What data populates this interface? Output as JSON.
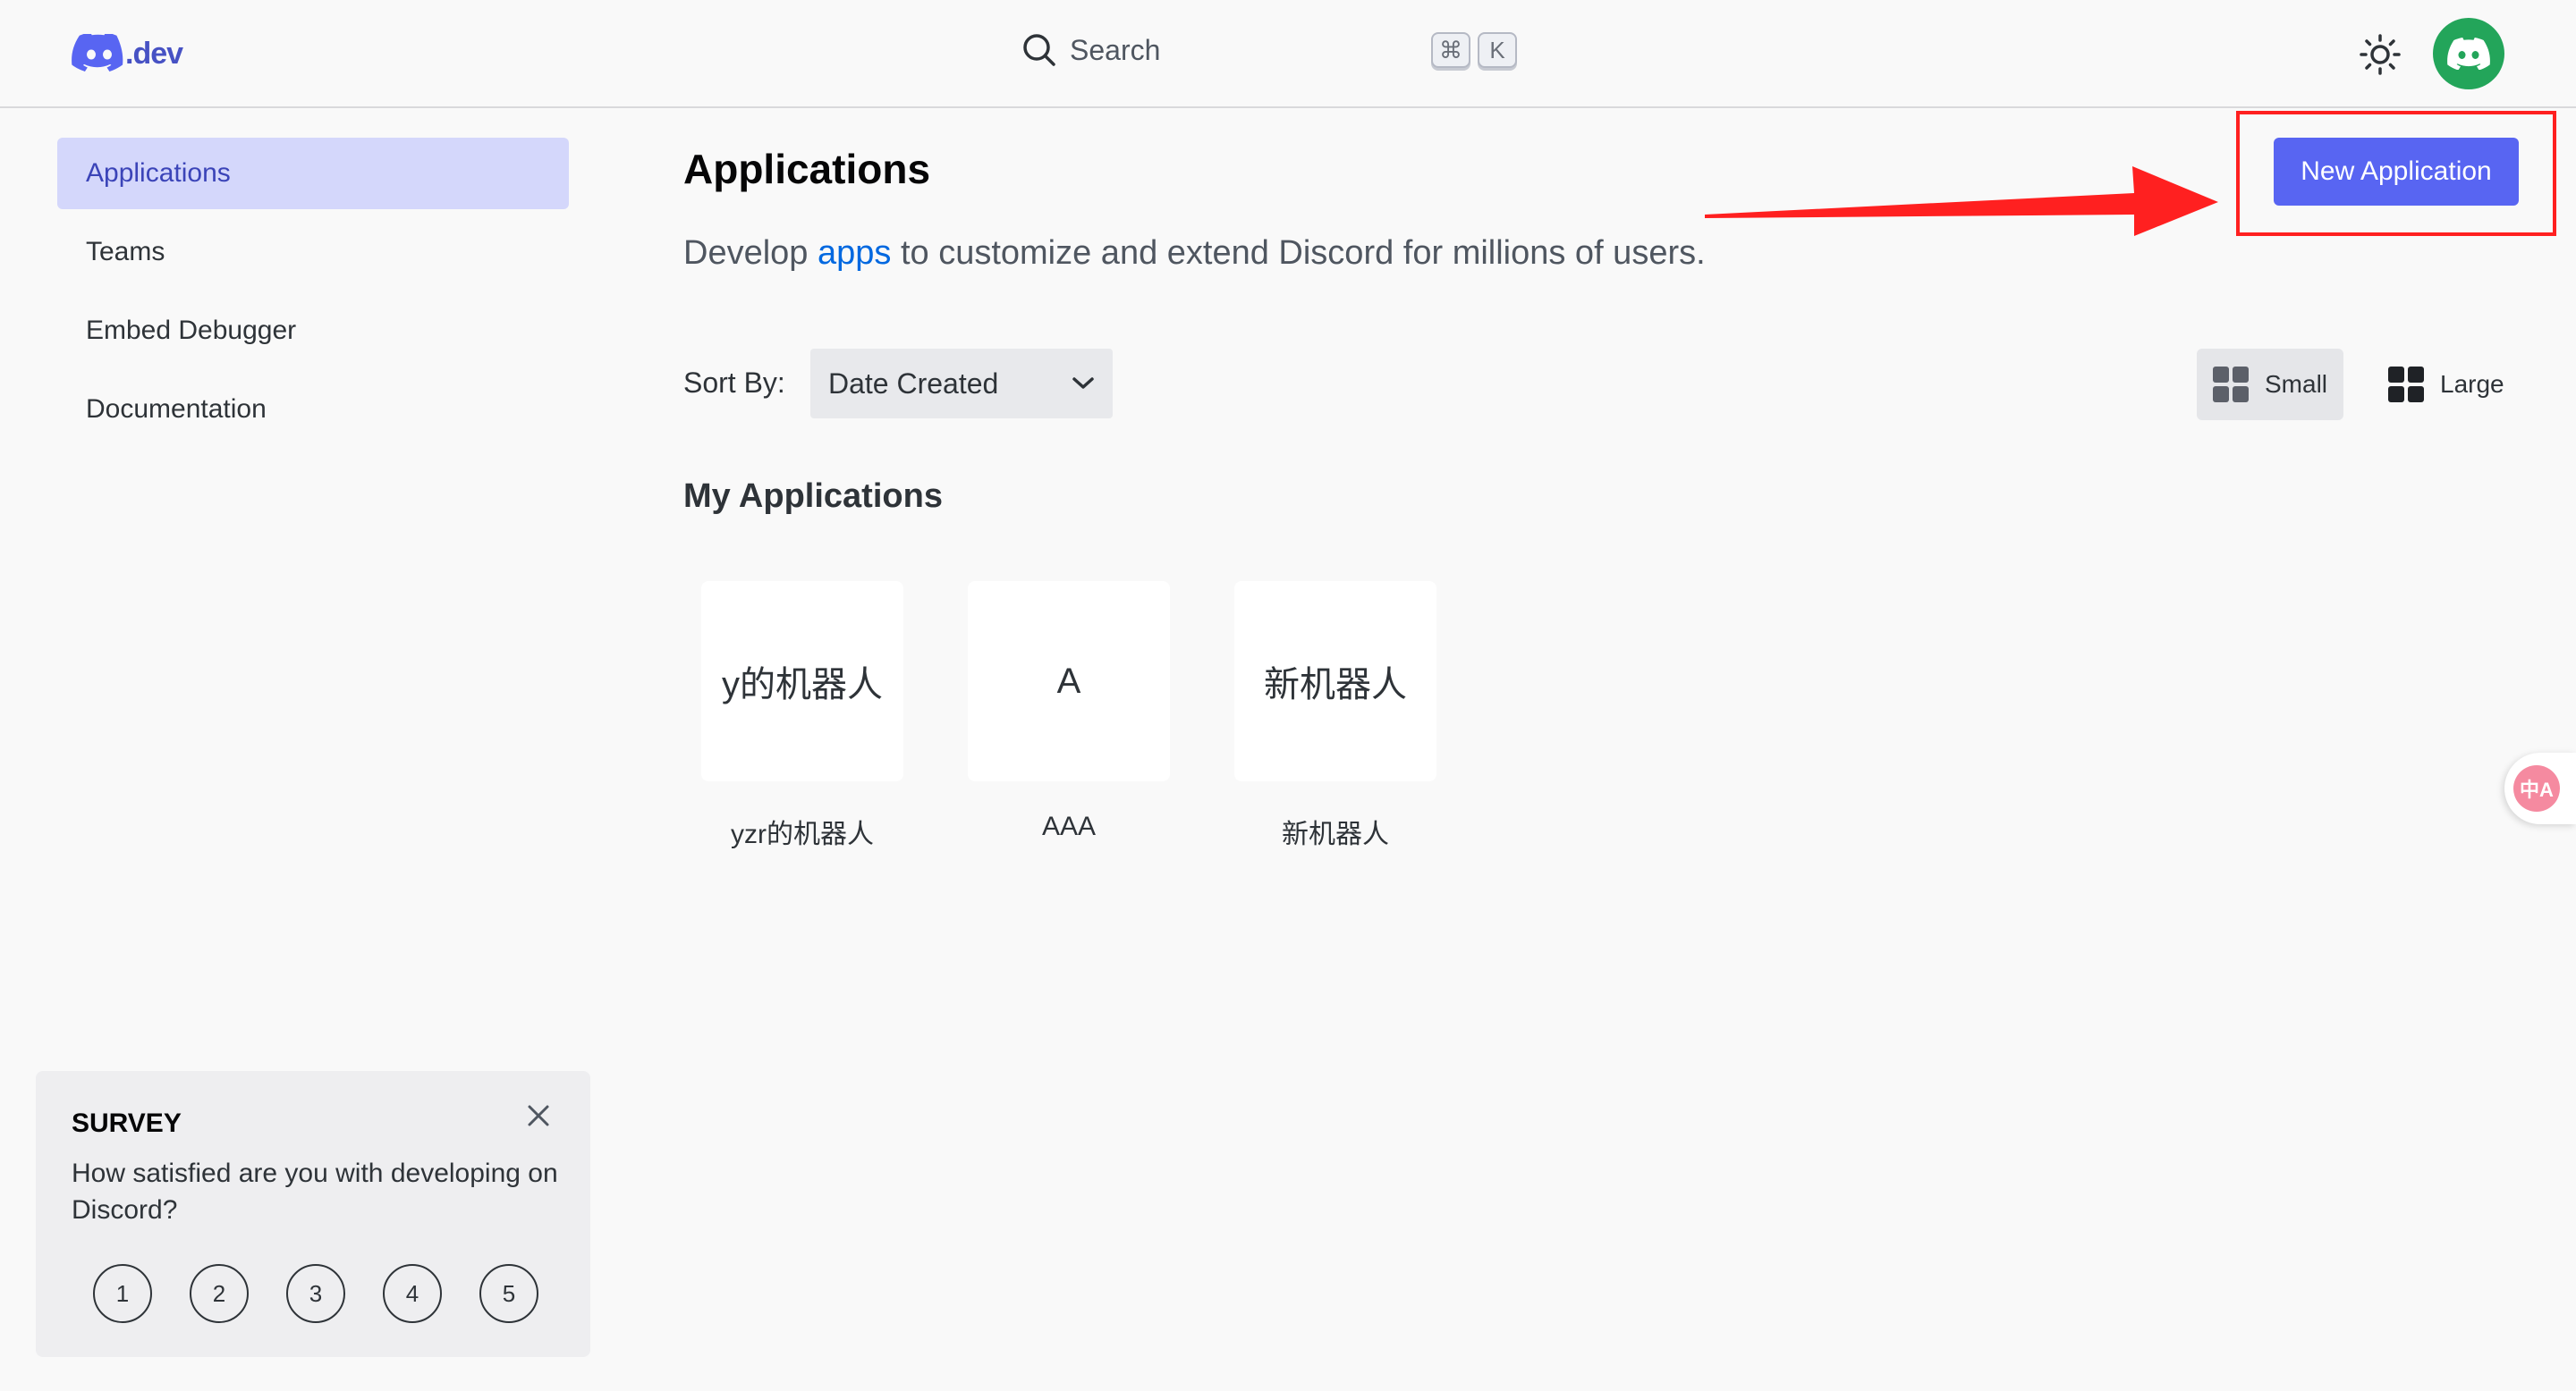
{
  "header": {
    "logo_suffix": ".dev",
    "search_label": "Search",
    "shortcut_keys": [
      "⌘",
      "K"
    ]
  },
  "sidebar": {
    "items": [
      {
        "label": "Applications",
        "active": true
      },
      {
        "label": "Teams",
        "active": false
      },
      {
        "label": "Embed Debugger",
        "active": false
      },
      {
        "label": "Documentation",
        "active": false
      }
    ]
  },
  "main": {
    "title": "Applications",
    "subtitle_pre": "Develop ",
    "subtitle_link": "apps",
    "subtitle_post": " to customize and extend Discord for millions of users.",
    "new_app_button": "New Application",
    "sort_label": "Sort By:",
    "sort_value": "Date Created",
    "view_small": "Small",
    "view_large": "Large",
    "section_title": "My Applications",
    "apps": [
      {
        "icon_text": "y的机器人",
        "name": "yzr的机器人"
      },
      {
        "icon_text": "A",
        "name": "AAA"
      },
      {
        "icon_text": "新机器人",
        "name": "新机器人"
      }
    ]
  },
  "survey": {
    "title": "SURVEY",
    "question": "How satisfied are you with developing on Discord?",
    "ratings": [
      "1",
      "2",
      "3",
      "4",
      "5"
    ]
  },
  "translate_fab": {
    "label": "中A"
  },
  "colors": {
    "accent": "#5865f2",
    "sidebar_active_bg": "#d4d7fb",
    "link": "#0068e0",
    "avatar_bg": "#23a55a",
    "annotation_red": "#ff2020"
  }
}
